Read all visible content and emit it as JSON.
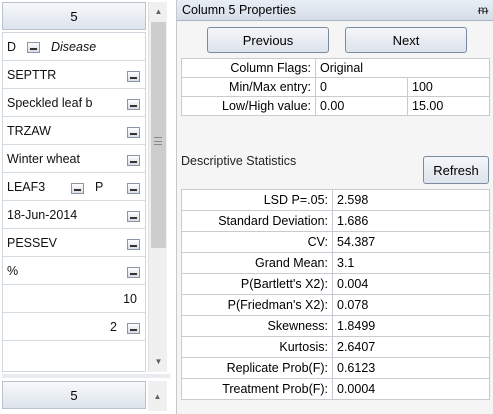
{
  "left": {
    "header": "5",
    "rows": [
      {
        "text": "D",
        "italic_text": "Disease",
        "dropdown": true
      },
      {
        "text": "SEPTTR",
        "dropdown": true
      },
      {
        "text": "Speckled leaf b",
        "dropdown": true
      },
      {
        "text": "TRZAW",
        "dropdown": true
      },
      {
        "text": "Winter wheat",
        "dropdown": true
      },
      {
        "text": "LEAF3",
        "text2": "P",
        "dropdown": true
      },
      {
        "text": "18-Jun-2014",
        "dropdown": true
      },
      {
        "text": "PESSEV",
        "dropdown": true
      },
      {
        "text": "%",
        "dropdown": true
      },
      {
        "text": "10",
        "dropdown": false
      },
      {
        "text": "2",
        "dropdown": true
      }
    ],
    "footer": "5"
  },
  "panel": {
    "title": "Column 5 Properties",
    "pin": "ᵽ",
    "previous": "Previous",
    "next": "Next",
    "flags_label": "Column Flags:",
    "flags_value": "Original",
    "minmax_label": "Min/Max entry:",
    "min_value": "0",
    "max_value": "100",
    "lowhigh_label": "Low/High value:",
    "low_value": "0.00",
    "high_value": "15.00",
    "stats_header": "Descriptive Statistics",
    "refresh": "Refresh",
    "stats": [
      {
        "label": "LSD P=.05:",
        "value": "2.598"
      },
      {
        "label": "Standard Deviation:",
        "value": "1.686"
      },
      {
        "label": "CV:",
        "value": "54.387"
      },
      {
        "label": "Grand Mean:",
        "value": "3.1"
      },
      {
        "label": "P(Bartlett's X2):",
        "value": "0.004"
      },
      {
        "label": "P(Friedman's X2):",
        "value": "0.078"
      },
      {
        "label": "Skewness:",
        "value": "1.8499"
      },
      {
        "label": "Kurtosis:",
        "value": "2.6407"
      },
      {
        "label": "Replicate Prob(F):",
        "value": "0.6123"
      },
      {
        "label": "Treatment Prob(F):",
        "value": "0.0004"
      }
    ]
  }
}
